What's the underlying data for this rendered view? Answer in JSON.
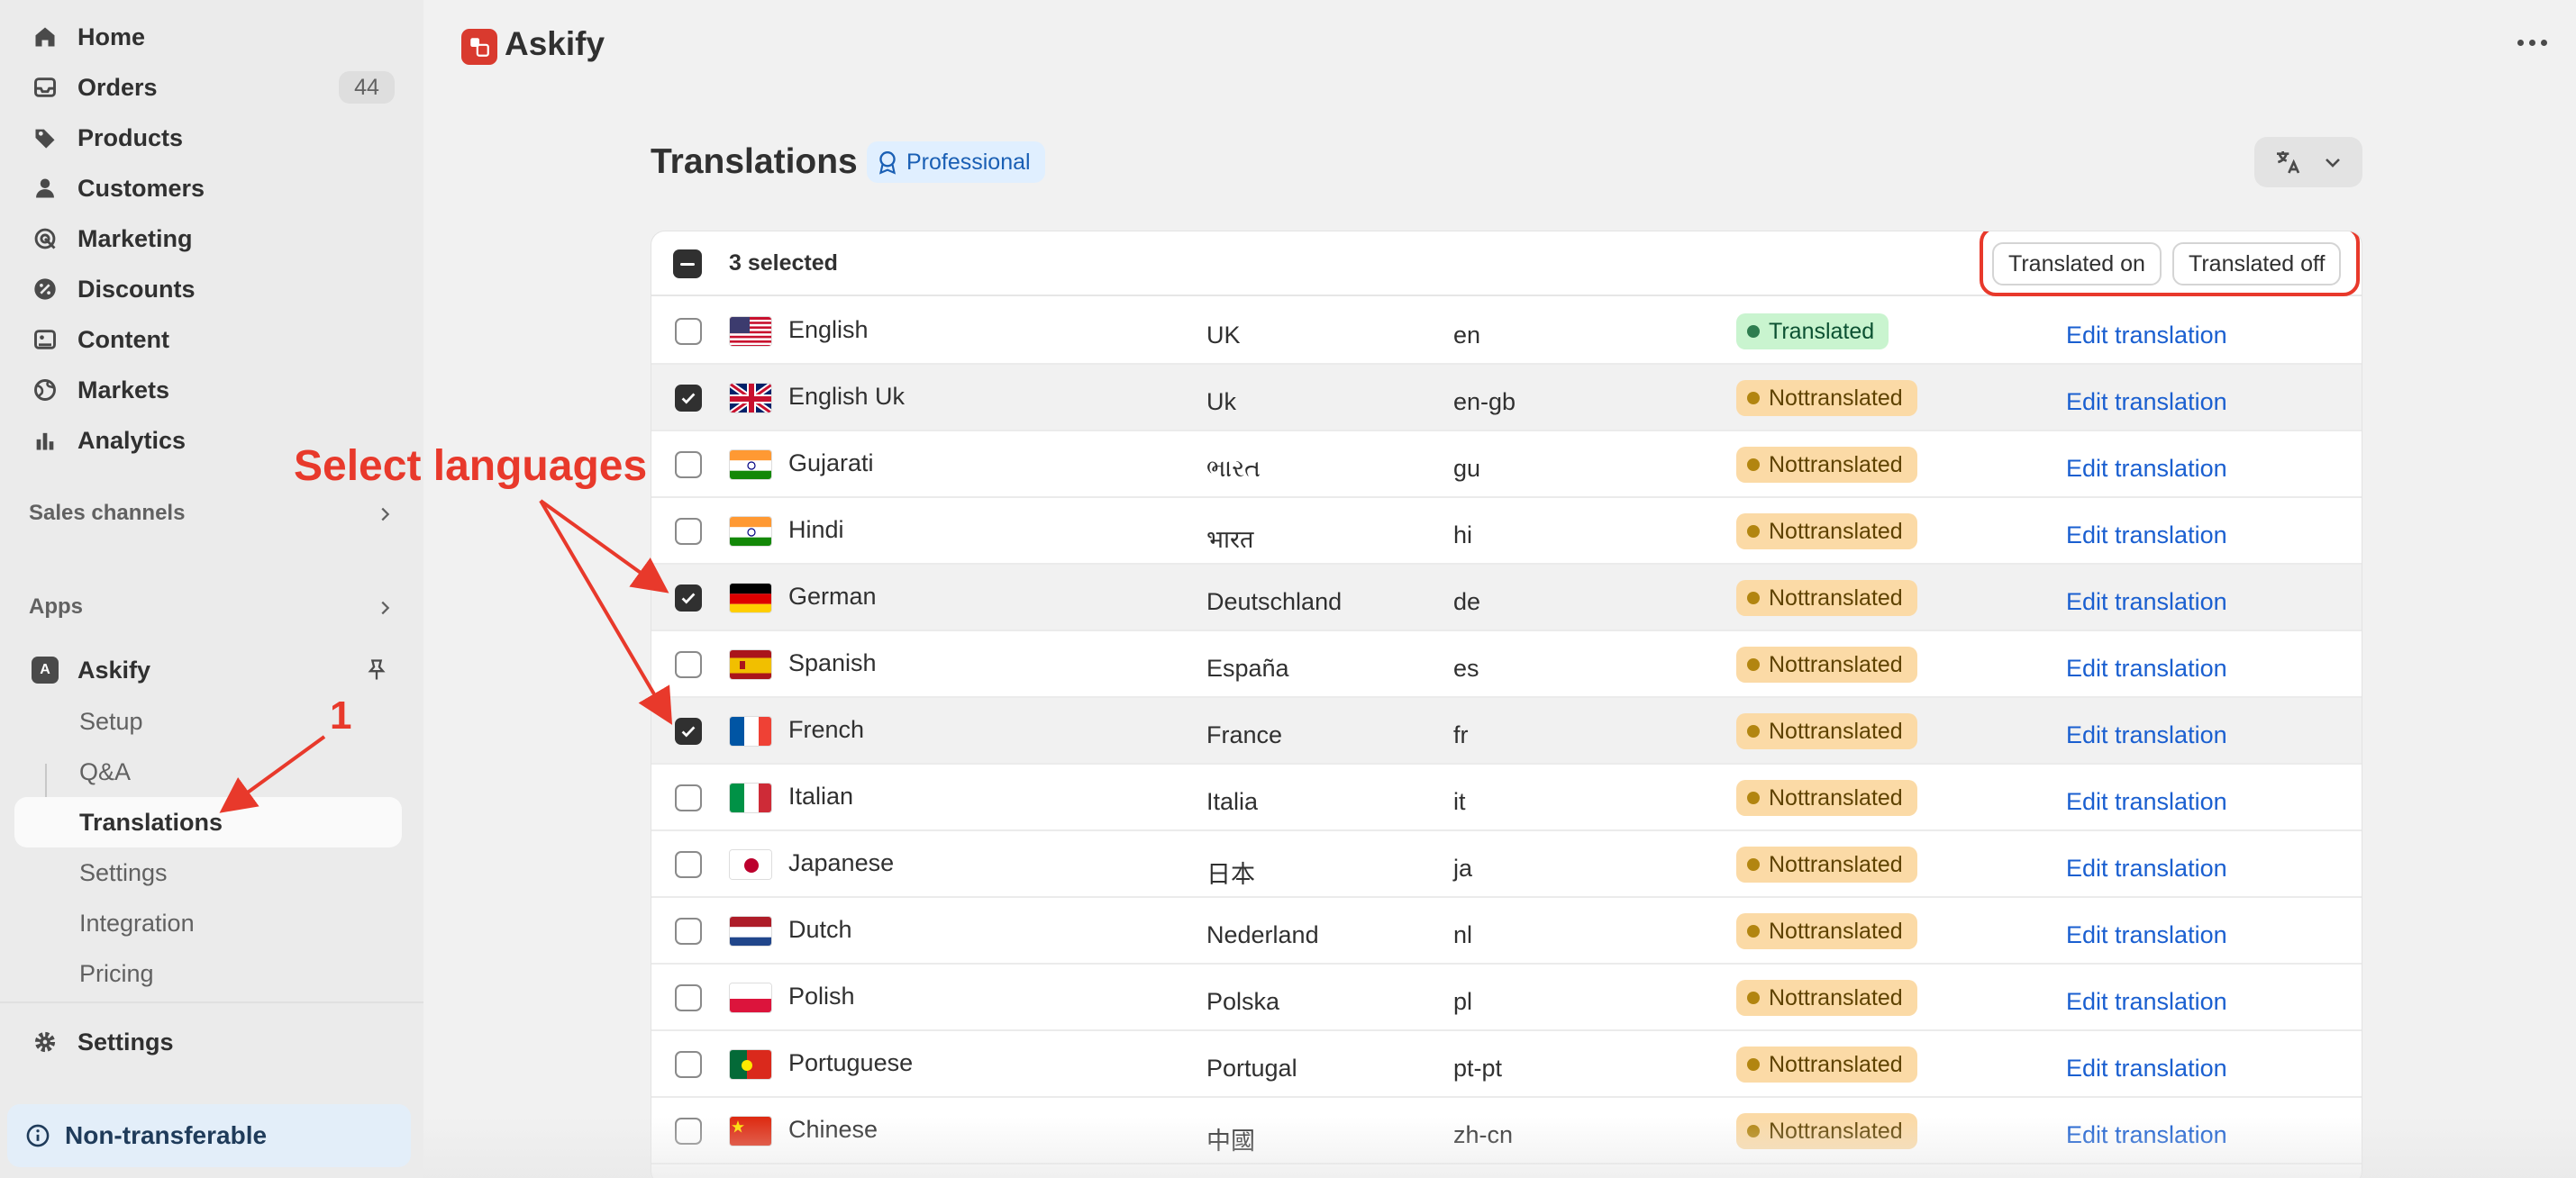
{
  "sidebar": {
    "nav": [
      {
        "label": "Home",
        "icon": "home-icon"
      },
      {
        "label": "Orders",
        "icon": "inbox-icon",
        "badge": "44"
      },
      {
        "label": "Products",
        "icon": "tag-icon"
      },
      {
        "label": "Customers",
        "icon": "person-icon"
      },
      {
        "label": "Marketing",
        "icon": "target-icon"
      },
      {
        "label": "Discounts",
        "icon": "discount-icon"
      },
      {
        "label": "Content",
        "icon": "content-icon"
      },
      {
        "label": "Markets",
        "icon": "globe-icon"
      },
      {
        "label": "Analytics",
        "icon": "bar-chart-icon"
      }
    ],
    "sales_channels": "Sales channels",
    "apps": "Apps",
    "app_name": "Askify",
    "app_sub": [
      "Setup",
      "Q&A",
      "Translations",
      "Settings",
      "Integration",
      "Pricing"
    ],
    "settings": "Settings",
    "footer": "Non-transferable"
  },
  "topbar": {
    "title": "Askify"
  },
  "page": {
    "title": "Translations",
    "plan_badge": "Professional",
    "selected_text": "3 selected",
    "translated_on": "Translated on",
    "translated_off": "Translated off"
  },
  "rows": [
    {
      "name": "English",
      "region": "UK",
      "code": "en",
      "status": "Translated",
      "action": "Edit translation",
      "selected": false
    },
    {
      "name": "English Uk",
      "region": "Uk",
      "code": "en-gb",
      "status": "Nottranslated",
      "action": "Edit translation",
      "selected": true
    },
    {
      "name": "Gujarati",
      "region": "ભારત",
      "code": "gu",
      "status": "Nottranslated",
      "action": "Edit translation",
      "selected": false
    },
    {
      "name": "Hindi",
      "region": "भारत",
      "code": "hi",
      "status": "Nottranslated",
      "action": "Edit translation",
      "selected": false
    },
    {
      "name": "German",
      "region": "Deutschland",
      "code": "de",
      "status": "Nottranslated",
      "action": "Edit translation",
      "selected": true
    },
    {
      "name": "Spanish",
      "region": "España",
      "code": "es",
      "status": "Nottranslated",
      "action": "Edit translation",
      "selected": false
    },
    {
      "name": "French",
      "region": "France",
      "code": "fr",
      "status": "Nottranslated",
      "action": "Edit translation",
      "selected": true
    },
    {
      "name": "Italian",
      "region": "Italia",
      "code": "it",
      "status": "Nottranslated",
      "action": "Edit translation",
      "selected": false
    },
    {
      "name": "Japanese",
      "region": "日本",
      "code": "ja",
      "status": "Nottranslated",
      "action": "Edit translation",
      "selected": false
    },
    {
      "name": "Dutch",
      "region": "Nederland",
      "code": "nl",
      "status": "Nottranslated",
      "action": "Edit translation",
      "selected": false
    },
    {
      "name": "Polish",
      "region": "Polska",
      "code": "pl",
      "status": "Nottranslated",
      "action": "Edit translation",
      "selected": false
    },
    {
      "name": "Portuguese",
      "region": "Portugal",
      "code": "pt-pt",
      "status": "Nottranslated",
      "action": "Edit translation",
      "selected": false
    },
    {
      "name": "Chinese",
      "region": "中國",
      "code": "zh-cn",
      "status": "Nottranslated",
      "action": "Edit translation",
      "selected": false
    }
  ],
  "annotations": {
    "select_languages": "Select languages",
    "step": "1"
  },
  "colors": {
    "accent_red": "#e8392b",
    "link_blue": "#1a5fd0",
    "translated_bg": "#c9f4cf",
    "not_translated_bg": "#fbdaa6"
  }
}
